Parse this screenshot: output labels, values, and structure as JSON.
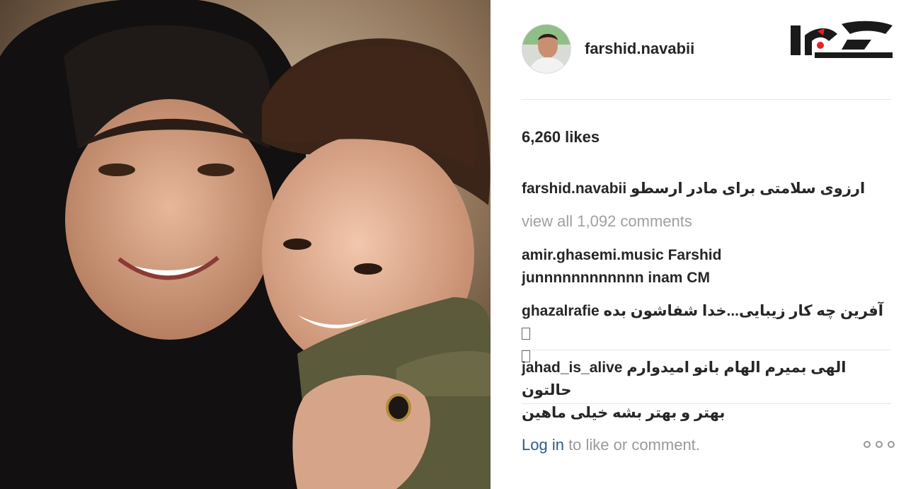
{
  "post": {
    "photo_icon": "photo-of-woman-and-boy",
    "author": {
      "username": "farshid.navabii",
      "avatar_icon": "profile-avatar"
    },
    "brand_logo_icon": "rokna-logo",
    "likes_text": "6,260 likes",
    "caption": {
      "username": "farshid.navabii",
      "text": "ارزوی سلامتی برای مادر ارسطو"
    },
    "view_all_comments": "view all 1,092 comments",
    "comments": [
      {
        "username": "amir.ghasemi.music",
        "text_line1": "Farshid",
        "text_line2": "junnnnnnnnnnnn inam CM"
      },
      {
        "username": "ghazalrafie",
        "text": "آفرین چه کار زیبایی...خدا شفاشون بده"
      },
      {
        "username": "jahad_is_alive",
        "text_line1": "الهی بمیرم الهام بانو امیدوارم حالتون",
        "text_line2": "بهتر و بهتر بشه خیلی ماهین"
      }
    ],
    "login_link": "Log in",
    "login_suffix": " to like or comment.",
    "more_icon": "more-options-icon"
  },
  "colors": {
    "link": "#2b5d87",
    "muted": "#a0a0a0",
    "logo_red": "#e3222a",
    "text": "#262626"
  }
}
